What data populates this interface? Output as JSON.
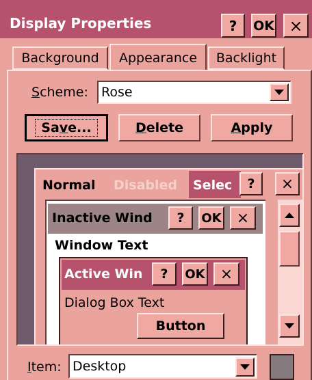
{
  "title": "Display Properties",
  "titlebar": {
    "help": "?",
    "ok": "OK",
    "close": "×"
  },
  "tabs": [
    "Background",
    "Appearance",
    "Backlight"
  ],
  "scheme": {
    "label_pre": "",
    "label_u": "S",
    "label_post": "cheme:",
    "value": "Rose"
  },
  "buttons": {
    "save_pre": "Sa",
    "save_u": "v",
    "save_post": "e...",
    "delete_u": "D",
    "delete_post": "elete",
    "apply_u": "A",
    "apply_post": "pply"
  },
  "preview": {
    "menu": {
      "normal": "Normal",
      "disabled": "Disabled",
      "selected": "Selec"
    },
    "inactive_title": "Inactive Wind",
    "window_text": "Window Text",
    "active_title": "Active Win",
    "dialog_text": "Dialog Box Text",
    "button": "Button",
    "help": "?",
    "ok": "OK",
    "close": "×"
  },
  "item": {
    "label_u": "I",
    "label_post": "tem:",
    "value": "Desktop"
  },
  "colors": {
    "title_bg": "#b7526c",
    "face": "#eaa39d",
    "inactive_title": "#9c8487",
    "desktop": "#6e5c6e"
  }
}
